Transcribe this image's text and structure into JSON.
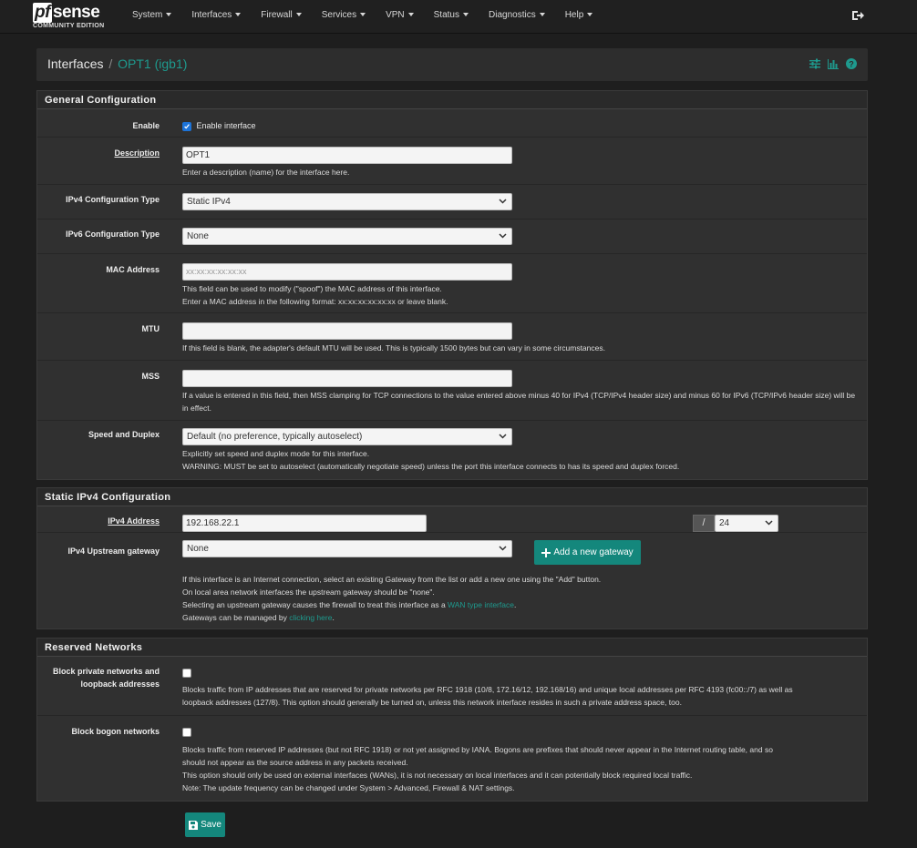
{
  "brand": {
    "logo_pf": "pf",
    "logo_text": "sense",
    "edition": "COMMUNITY EDITION"
  },
  "nav": {
    "items": [
      {
        "label": "System"
      },
      {
        "label": "Interfaces"
      },
      {
        "label": "Firewall"
      },
      {
        "label": "Services"
      },
      {
        "label": "VPN"
      },
      {
        "label": "Status"
      },
      {
        "label": "Diagnostics"
      },
      {
        "label": "Help"
      }
    ],
    "logout_icon": "sign-out-icon"
  },
  "header": {
    "breadcrumb_parent": "Interfaces",
    "breadcrumb_sep": "/",
    "breadcrumb_current": "OPT1 (igb1)",
    "icons": [
      "sliders-icon",
      "bar-chart-icon",
      "help-circle-icon"
    ]
  },
  "general": {
    "title": "General Configuration",
    "enable": {
      "label": "Enable",
      "text": "Enable interface",
      "checked": true
    },
    "description": {
      "label": "Description",
      "value": "OPT1",
      "help": "Enter a description (name) for the interface here."
    },
    "ipv4_type": {
      "label": "IPv4 Configuration Type",
      "value": "Static IPv4"
    },
    "ipv6_type": {
      "label": "IPv6 Configuration Type",
      "value": "None"
    },
    "mac": {
      "label": "MAC Address",
      "placeholder": "xx:xx:xx:xx:xx:xx",
      "help1": "This field can be used to modify (\"spoof\") the MAC address of this interface.",
      "help2": "Enter a MAC address in the following format: xx:xx:xx:xx:xx:xx or leave blank."
    },
    "mtu": {
      "label": "MTU",
      "value": "",
      "help": "If this field is blank, the adapter's default MTU will be used. This is typically 1500 bytes but can vary in some circumstances."
    },
    "mss": {
      "label": "MSS",
      "value": "",
      "help": "If a value is entered in this field, then MSS clamping for TCP connections to the value entered above minus 40 for IPv4 (TCP/IPv4 header size) and minus 60 for IPv6 (TCP/IPv6 header size) will be in effect."
    },
    "speed": {
      "label": "Speed and Duplex",
      "value": "Default (no preference, typically autoselect)",
      "help1": "Explicitly set speed and duplex mode for this interface.",
      "help2": "WARNING: MUST be set to autoselect (automatically negotiate speed) unless the port this interface connects to has its speed and duplex forced."
    }
  },
  "static_ipv4": {
    "title": "Static IPv4 Configuration",
    "address": {
      "label": "IPv4 Address",
      "value": "192.168.22.1",
      "slash": "/",
      "cidr": "24"
    },
    "gateway": {
      "label": "IPv4 Upstream gateway",
      "value": "None",
      "add_button": "Add a new gateway",
      "help1": "If this interface is an Internet connection, select an existing Gateway from the list or add a new one using the \"Add\" button.",
      "help2": "On local area network interfaces the upstream gateway should be \"none\".",
      "help3_pre": "Selecting an upstream gateway causes the firewall to treat this interface as a ",
      "help3_link": "WAN type interface",
      "help3_post": ".",
      "help4_pre": "Gateways can be managed by ",
      "help4_link": "clicking here",
      "help4_post": "."
    }
  },
  "reserved": {
    "title": "Reserved Networks",
    "private": {
      "label_line1": "Block private networks and",
      "label_line2": "loopback addresses",
      "checked": false,
      "help1": "Blocks traffic from IP addresses that are reserved for private networks per RFC 1918 (10/8, 172.16/12, 192.168/16) and unique local addresses per RFC 4193 (fc00::/7) as well as",
      "help2": "loopback addresses (127/8). This option should generally be turned on, unless this network interface resides in such a private address space, too."
    },
    "bogon": {
      "label": "Block bogon networks",
      "checked": false,
      "help1": "Blocks traffic from reserved IP addresses (but not RFC 1918) or not yet assigned by IANA. Bogons are prefixes that should never appear in the Internet routing table, and so",
      "help2": "should not appear as the source address in any packets received.",
      "help3": "This option should only be used on external interfaces (WANs), it is not necessary on local interfaces and it can potentially block required local traffic.",
      "help4": "Note: The update frequency can be changed under System > Advanced, Firewall & NAT settings."
    }
  },
  "save": {
    "label": "Save"
  },
  "colors": {
    "accent": "#1e9a8e",
    "button": "#14877c",
    "checkbox": "#1c73d8"
  }
}
